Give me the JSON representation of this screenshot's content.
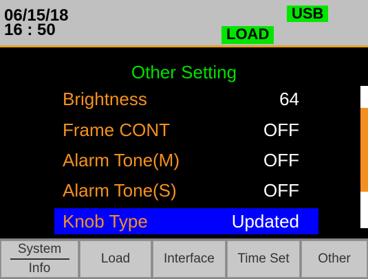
{
  "status": {
    "date": "06/15/18",
    "time": "16 : 50",
    "usb_badge": "USB",
    "load_badge": "LOAD"
  },
  "menu": {
    "title": "Other Setting",
    "items": [
      {
        "label": "Brightness",
        "value": "64",
        "selected": false
      },
      {
        "label": "Frame CONT",
        "value": "OFF",
        "selected": false
      },
      {
        "label": "Alarm Tone(M)",
        "value": "OFF",
        "selected": false
      },
      {
        "label": "Alarm Tone(S)",
        "value": "OFF",
        "selected": false
      },
      {
        "label": "Knob Type",
        "value": "Updated",
        "selected": true
      }
    ]
  },
  "softkeys": {
    "system_line1": "System",
    "system_line2": "Info",
    "load": "Load",
    "interface": "Interface",
    "time_set": "Time Set",
    "other": "Other"
  },
  "colors": {
    "accent_orange": "#f59020",
    "title_green": "#00e000",
    "badge_green": "#00e600",
    "selection_blue": "#0000ff"
  }
}
